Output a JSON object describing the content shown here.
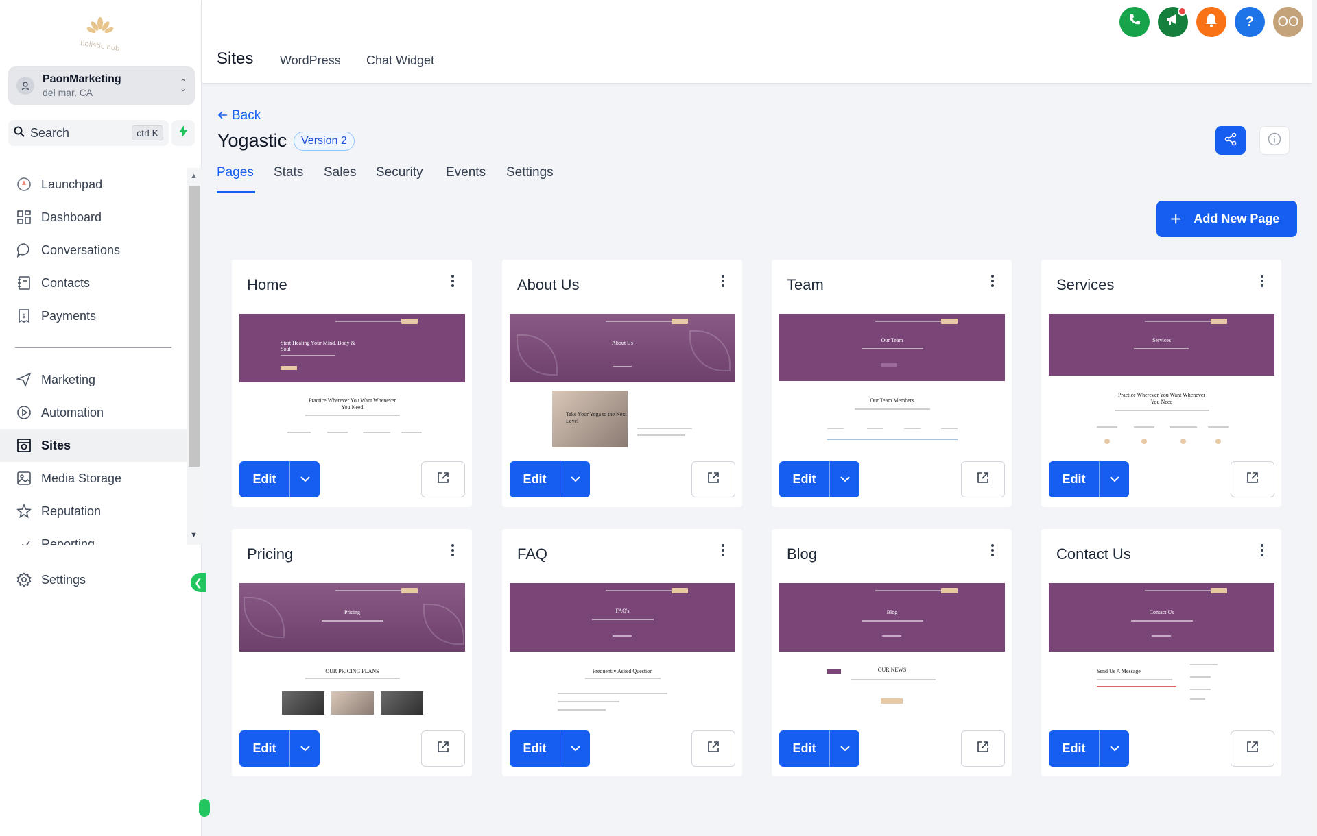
{
  "sidebar": {
    "account": {
      "name": "PaonMarketing",
      "location": "del mar, CA"
    },
    "search": {
      "label": "Search",
      "shortcut": "ctrl K"
    },
    "items": [
      {
        "label": "Launchpad",
        "icon": "launchpad-icon"
      },
      {
        "label": "Dashboard",
        "icon": "dashboard-icon"
      },
      {
        "label": "Conversations",
        "icon": "chat-icon"
      },
      {
        "label": "Contacts",
        "icon": "contacts-icon"
      },
      {
        "label": "Payments",
        "icon": "payments-icon"
      },
      {
        "label": "Marketing",
        "icon": "send-icon"
      },
      {
        "label": "Automation",
        "icon": "automation-icon"
      },
      {
        "label": "Sites",
        "icon": "sites-icon",
        "active": true
      },
      {
        "label": "Media Storage",
        "icon": "image-icon"
      },
      {
        "label": "Reputation",
        "icon": "star-icon"
      },
      {
        "label": "Reporting",
        "icon": "reporting-icon"
      }
    ],
    "settings_label": "Settings"
  },
  "header": {
    "title": "Sites",
    "tabs": [
      "WordPress",
      "Chat Widget"
    ],
    "avatar_initials": "OO",
    "help_label": "?",
    "icon_colors": {
      "phone": "#16a34a",
      "megaphone": "#15803d",
      "bell": "#f97316",
      "help": "#1d73e8",
      "avatar": "#c4a27a"
    }
  },
  "main": {
    "back_label": "Back",
    "site_title": "Yogastic",
    "version_badge": "Version 2",
    "tabs": [
      "Pages",
      "Stats",
      "Sales",
      "Security",
      "Events",
      "Settings"
    ],
    "active_tab": "Pages",
    "add_button": "Add New Page",
    "edit_label": "Edit",
    "pages": [
      {
        "title": "Home",
        "hero": "Start Healing Your Mind, Body & Soul",
        "section": "Practice Wherever You Want Whenever You Need"
      },
      {
        "title": "About Us",
        "hero": "About Us",
        "section": "Take Your Yoga to the Next Level"
      },
      {
        "title": "Team",
        "hero": "Our Team",
        "section": "Our Team Members"
      },
      {
        "title": "Services",
        "hero": "Services",
        "section": "Practice Wherever You Want Whenever You Need"
      },
      {
        "title": "Pricing",
        "hero": "Pricing",
        "section": "OUR PRICING PLANS"
      },
      {
        "title": "FAQ",
        "hero": "FAQ's",
        "section": "Frequently Asked Question"
      },
      {
        "title": "Blog",
        "hero": "Blog",
        "section": "OUR NEWS"
      },
      {
        "title": "Contact Us",
        "hero": "Contact Us",
        "section": "Send Us A Message"
      }
    ]
  },
  "colors": {
    "primary": "#155eef",
    "hero_purple": "#7a4678",
    "accent_beige": "#e8c9a6",
    "toggle_green": "#22c55e"
  }
}
